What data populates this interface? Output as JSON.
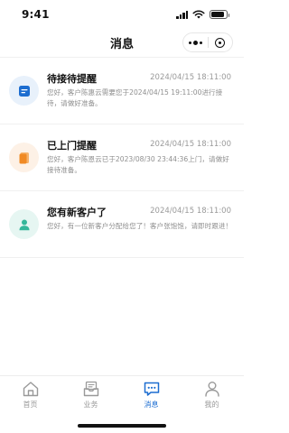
{
  "status_bar": {
    "time": "9:41",
    "battery_level": 0.85
  },
  "nav": {
    "title": "消息"
  },
  "messages": [
    {
      "title": "待接待提醒",
      "time": "2024/04/15 18:11:00",
      "body": "您好，客户陈惠云需要您于2024/04/15 19:11:00进行接待，请做好准备。",
      "icon": "notepad-icon",
      "icon_bg": "#e8f1fb",
      "icon_color": "#1c6dd0"
    },
    {
      "title": "已上门提醒",
      "time": "2024/04/15 18:11:00",
      "body": "您好，客户陈恩云已于2023/08/30  23:44:36上门，请做好接待准备。",
      "icon": "document-icon",
      "icon_bg": "#fdf1e6",
      "icon_color": "#f08a24"
    },
    {
      "title": "您有新客户了",
      "time": "2024/04/15 18:11:00",
      "body": "您好，有一位新客户分配给您了！客户张饱饱，请即时跟进！",
      "icon": "user-icon",
      "icon_bg": "#e6f6f2",
      "icon_color": "#35b79a"
    }
  ],
  "tabs": [
    {
      "label": "首页",
      "icon": "home-icon",
      "active": false
    },
    {
      "label": "业务",
      "icon": "inbox-icon",
      "active": false
    },
    {
      "label": "消息",
      "icon": "chat-icon",
      "active": true
    },
    {
      "label": "我的",
      "icon": "profile-icon",
      "active": false
    }
  ],
  "colors": {
    "accent": "#1c6dd0",
    "inactive": "#999999"
  }
}
